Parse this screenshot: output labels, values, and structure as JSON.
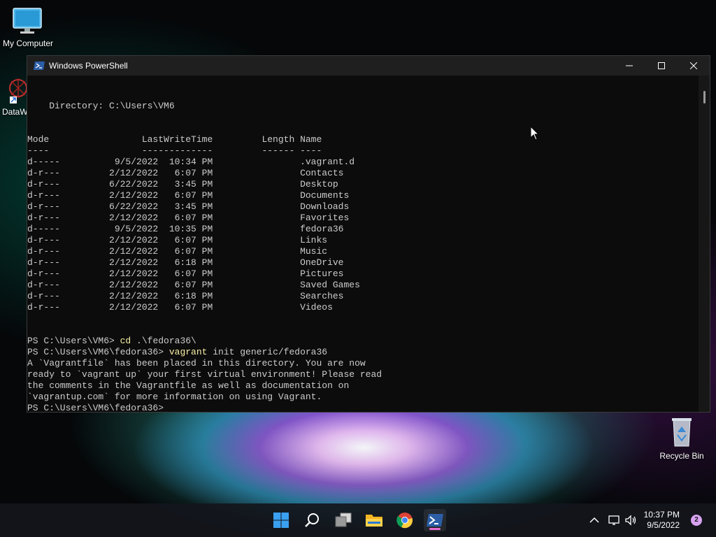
{
  "desktop": {
    "icons": [
      {
        "label": "My Computer"
      },
      {
        "label": "DataW"
      },
      {
        "label": "Recycle Bin"
      }
    ]
  },
  "window": {
    "title": "Windows PowerShell",
    "minimize_icon": "minimize-icon",
    "maximize_icon": "maximize-icon",
    "close_icon": "close-icon"
  },
  "console": {
    "lines": [
      "",
      "",
      "    Directory: C:\\Users\\VM6",
      "",
      "",
      "Mode                 LastWriteTime         Length Name",
      "----                 -------------         ------ ----",
      "d-----          9/5/2022  10:34 PM                .vagrant.d",
      "d-r---         2/12/2022   6:07 PM                Contacts",
      "d-r---         6/22/2022   3:45 PM                Desktop",
      "d-r---         2/12/2022   6:07 PM                Documents",
      "d-r---         6/22/2022   3:45 PM                Downloads",
      "d-r---         2/12/2022   6:07 PM                Favorites",
      "d-----          9/5/2022  10:35 PM                fedora36",
      "d-r---         2/12/2022   6:07 PM                Links",
      "d-r---         2/12/2022   6:07 PM                Music",
      "d-r---         2/12/2022   6:18 PM                OneDrive",
      "d-r---         2/12/2022   6:07 PM                Pictures",
      "d-r---         2/12/2022   6:07 PM                Saved Games",
      "d-r---         2/12/2022   6:18 PM                Searches",
      "d-r---         2/12/2022   6:07 PM                Videos",
      "",
      "",
      "A `Vagrantfile` has been placed in this directory. You are now",
      "ready to `vagrant up` your first virtual environment! Please read",
      "the comments in the Vagrantfile as well as documentation on",
      "`vagrantup.com` for more information on using Vagrant.",
      ""
    ],
    "cmd1": {
      "prompt": "PS C:\\Users\\VM6> ",
      "cmd": "cd",
      "args": " .\\fedora36\\"
    },
    "cmd2": {
      "prompt": "PS C:\\Users\\VM6\\fedora36> ",
      "cmd": "vagrant",
      "args": " init generic/fedora36"
    },
    "final_prompt": "PS C:\\Users\\VM6\\fedora36>"
  },
  "taskbar": {
    "apps": [
      "start-icon",
      "search-icon",
      "task-view-icon",
      "file-explorer-icon",
      "chrome-icon",
      "powershell-icon"
    ],
    "clock_time": "10:37 PM",
    "clock_date": "9/5/2022",
    "notification_count": "2"
  },
  "colors": {
    "console_bg": "#0c0c0c",
    "console_text": "#cccccc",
    "command_yellow": "#f9f1a5",
    "taskbar_indicator": "#e86ad0"
  }
}
